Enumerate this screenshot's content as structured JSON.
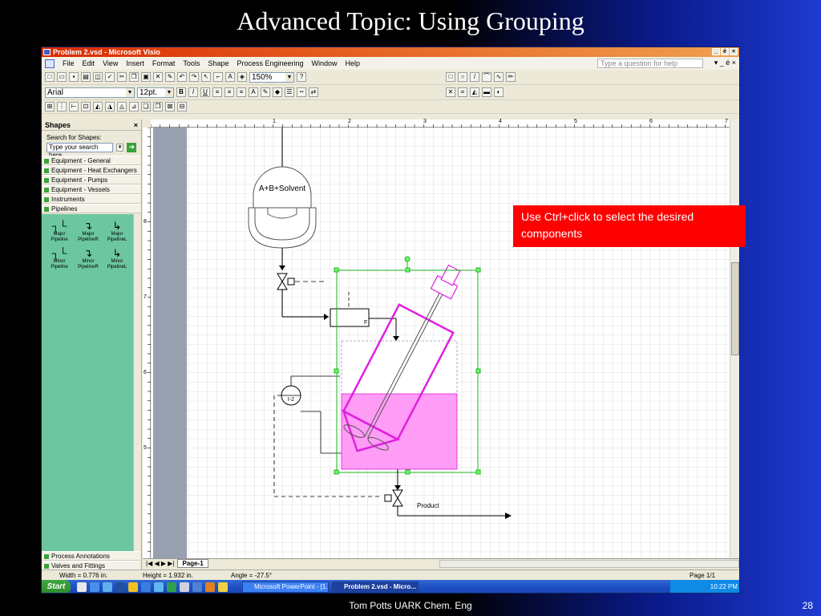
{
  "slide": {
    "title": "Advanced Topic: Using Grouping",
    "footer": "Tom Potts  UARK Chem. Eng",
    "page_number": "28"
  },
  "window": {
    "title": "Problem 2.vsd - Microsoft Visio",
    "title_buttons": [
      "_",
      "é",
      "×"
    ]
  },
  "menu": {
    "items": [
      "File",
      "Edit",
      "View",
      "Insert",
      "Format",
      "Tools",
      "Shape",
      "Process Engineering",
      "Window",
      "Help"
    ],
    "help_placeholder": "Type a question for help",
    "right_controls": "▾  _  é  ×"
  },
  "toolbar": {
    "zoom": "150%",
    "font": "Arial",
    "font_size": "12pt."
  },
  "shapes_panel": {
    "title": "Shapes",
    "close": "×",
    "search_label": "Search for Shapes:",
    "search_placeholder": "Type your search here",
    "stencils": [
      "Equipment - General",
      "Equipment - Heat Exchangers",
      "Equipment - Pumps",
      "Equipment - Vessels",
      "Instruments",
      "Pipelines"
    ],
    "masters": [
      {
        "glyph": "┐└",
        "label": "Major Pipeline"
      },
      {
        "glyph": "↴",
        "label": "Major PipelineR"
      },
      {
        "glyph": "↳",
        "label": "Major PipelineL"
      },
      {
        "glyph": "┐└",
        "label": "Minor Pipeline"
      },
      {
        "glyph": "↴",
        "label": "Minor PipelineR"
      },
      {
        "glyph": "↳",
        "label": "Minor PipelineL"
      }
    ],
    "bottom_stencils": [
      "Process Annotations",
      "Valves and Fittings"
    ]
  },
  "ruler": {
    "h_labels": [
      "1",
      "2",
      "3",
      "4",
      "5",
      "6",
      "7"
    ],
    "v_labels": [
      "8",
      "7",
      "6",
      "5"
    ]
  },
  "diagram": {
    "vessel_label": "A+B+Solvent",
    "controller_label": "F",
    "indicator_label": "I-2",
    "product_label": "Product"
  },
  "tabbar": {
    "nav": "|◀ ◀ ▶ ▶|",
    "page_tab": "Page-1"
  },
  "status": {
    "width": "Width = 0.776 in.",
    "height": "Height = 1.932 in.",
    "angle": "Angle = -27.5°",
    "page": "Page 1/1"
  },
  "taskbar": {
    "start": "Start",
    "tasks": [
      "Microsoft PowerPoint - [1...",
      "Problem 2.vsd - Micro..."
    ],
    "time": "10:22 PM"
  },
  "callout": {
    "text": "Use Ctrl+click to select the desired components"
  },
  "colors": {
    "selection_magenta": "#e020e0",
    "fill_pink": "#ff9cf5",
    "handle_green": "#1fb31f",
    "callout_red": "#ff0000",
    "page_margin_gray": "#98a0b0"
  }
}
